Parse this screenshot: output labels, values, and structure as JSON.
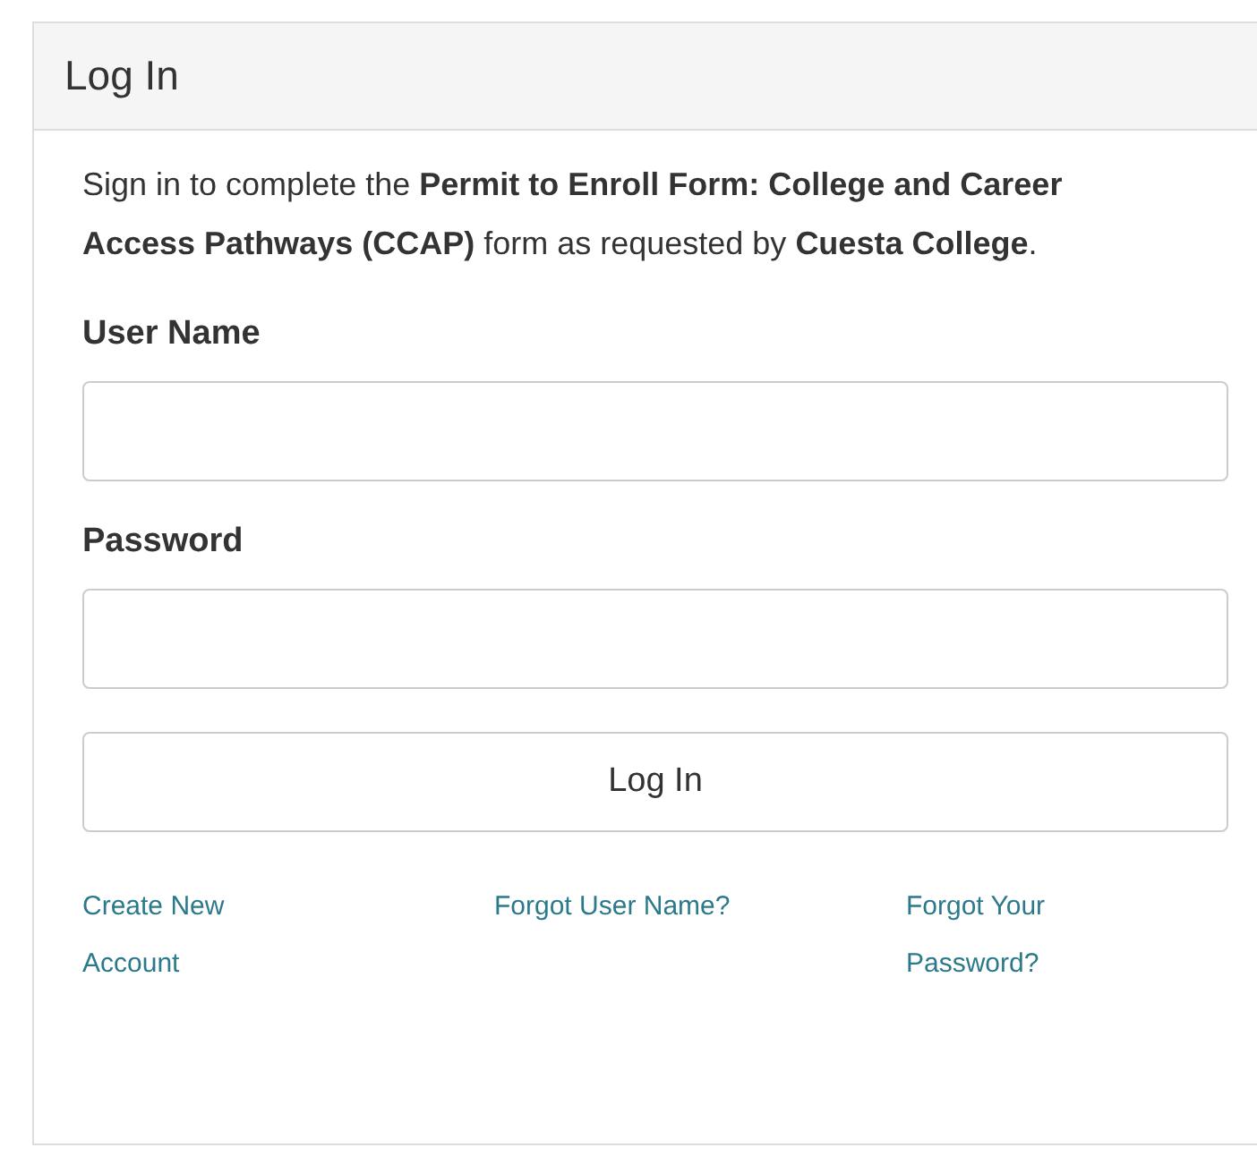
{
  "panel": {
    "title": "Log In"
  },
  "intro": "Sign in to complete the **Permit to Enroll Form: College and Career Access Pathways (CCAP)** form as requested by **Cuesta College**.",
  "fields": [
    {
      "label": "User Name"
    },
    {
      "label": "Password"
    }
  ],
  "submit": "Log In",
  "links": [
    "Create New Account",
    "Forgot User Name?",
    "Forgot Your Password?"
  ]
}
